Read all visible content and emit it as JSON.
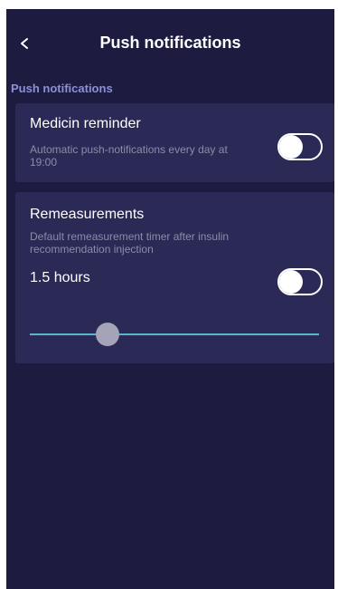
{
  "header": {
    "back_icon": "chevron-left-icon",
    "title": "Push notifications"
  },
  "section": {
    "label": "Push notifications"
  },
  "medicin_reminder": {
    "title": "Medicin reminder",
    "description_line1": "Automatic push-notifications every day at",
    "description_line2": "19:00",
    "enabled": false
  },
  "remeasurements": {
    "title": "Remeasurements",
    "description_line1": "Default remeasurement timer after insulin",
    "description_line2": "recommendation injection",
    "value_label": "1.5 hours",
    "enabled": false,
    "slider_fraction": 0.27
  },
  "colors": {
    "background": "#1d1c40",
    "card": "#2b2a56",
    "section_label": "#8c8fd9",
    "slider_track": "#56b7c8",
    "slider_thumb": "#a4a3b8",
    "toggle": "#ffffff"
  }
}
